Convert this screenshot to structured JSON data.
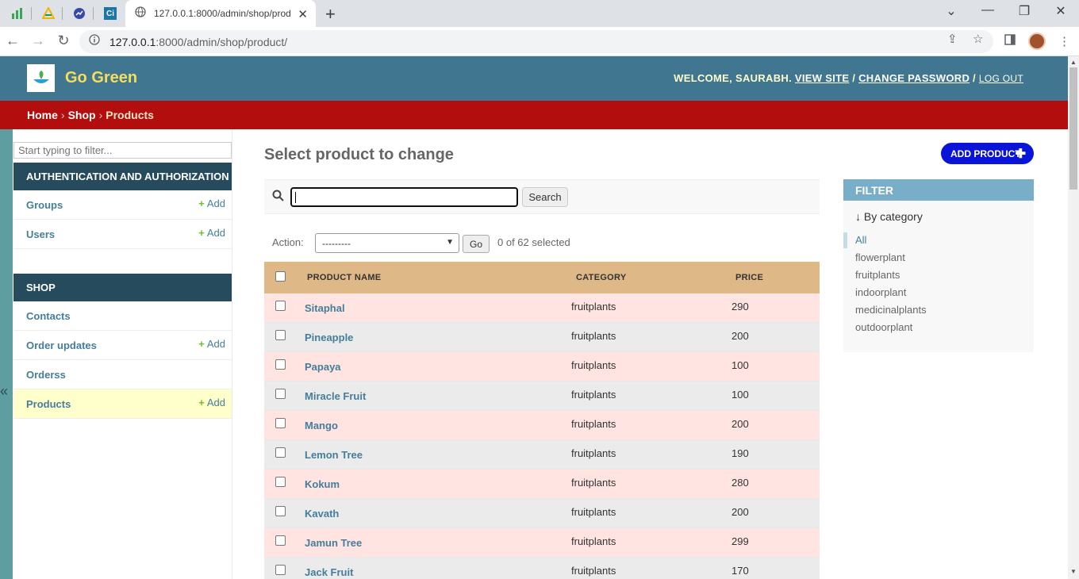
{
  "browser": {
    "active_tab_title": "127.0.0.1:8000/admin/shop/prod",
    "url_host": "127.0.0.1",
    "url_rest": ":8000/admin/shop/product/",
    "pinned_tab_icons": [
      "sheets-icon",
      "drive-icon",
      "analytics-icon",
      "ci-icon"
    ],
    "pinned_ci_label": "Ci"
  },
  "header": {
    "brand": "Go Green",
    "welcome": "WELCOME, ",
    "username": "SAURABH",
    "view_site": "VIEW SITE",
    "change_password": "CHANGE PASSWORD",
    "log_out": "LOG OUT"
  },
  "breadcrumbs": {
    "home": "Home",
    "shop": "Shop",
    "current": "Products",
    "separator": "›"
  },
  "sidebar": {
    "filter_placeholder": "Start typing to filter...",
    "add_label": "Add",
    "auth_header": "AUTHENTICATION AND AUTHORIZATION",
    "auth_items": [
      {
        "label": "Groups",
        "has_add": true
      },
      {
        "label": "Users",
        "has_add": true
      }
    ],
    "shop_header": "SHOP",
    "shop_items": [
      {
        "label": "Contacts",
        "has_add": false
      },
      {
        "label": "Order updates",
        "has_add": true
      },
      {
        "label": "Orderss",
        "has_add": false
      },
      {
        "label": "Products",
        "has_add": true,
        "active": true
      }
    ]
  },
  "main": {
    "title": "Select product to change",
    "add_button": "ADD PRODUCT",
    "search_button": "Search",
    "action_label": "Action:",
    "action_select": "---------",
    "go_button": "Go",
    "selected_count": "0 of 62 selected",
    "columns": [
      "PRODUCT NAME",
      "CATEGORY",
      "PRICE"
    ],
    "rows": [
      {
        "name": "Sitaphal",
        "category": "fruitplants",
        "price": "290"
      },
      {
        "name": "Pineapple",
        "category": "fruitplants",
        "price": "200"
      },
      {
        "name": "Papaya",
        "category": "fruitplants",
        "price": "100"
      },
      {
        "name": "Miracle Fruit",
        "category": "fruitplants",
        "price": "100"
      },
      {
        "name": "Mango",
        "category": "fruitplants",
        "price": "200"
      },
      {
        "name": "Lemon Tree",
        "category": "fruitplants",
        "price": "190"
      },
      {
        "name": "Kokum",
        "category": "fruitplants",
        "price": "280"
      },
      {
        "name": "Kavath",
        "category": "fruitplants",
        "price": "200"
      },
      {
        "name": "Jamun Tree",
        "category": "fruitplants",
        "price": "299"
      },
      {
        "name": "Jack Fruit",
        "category": "fruitplants",
        "price": "170"
      }
    ]
  },
  "filter": {
    "title": "FILTER",
    "by_category": "↓ By category",
    "options": [
      "All",
      "flowerplant",
      "fruitplants",
      "indoorplant",
      "medicinalplants",
      "outdoorplant"
    ],
    "selected": "All"
  },
  "colors": {
    "header_bg": "#417690",
    "brand": "#f5dd5d",
    "breadcrumbs_bg": "#b30e0e",
    "module_header": "#264b5d",
    "table_head": "#deb887",
    "row_odd": "#ffe4e1",
    "row_even": "#ebebeb",
    "add_button": "#0a14d8"
  }
}
